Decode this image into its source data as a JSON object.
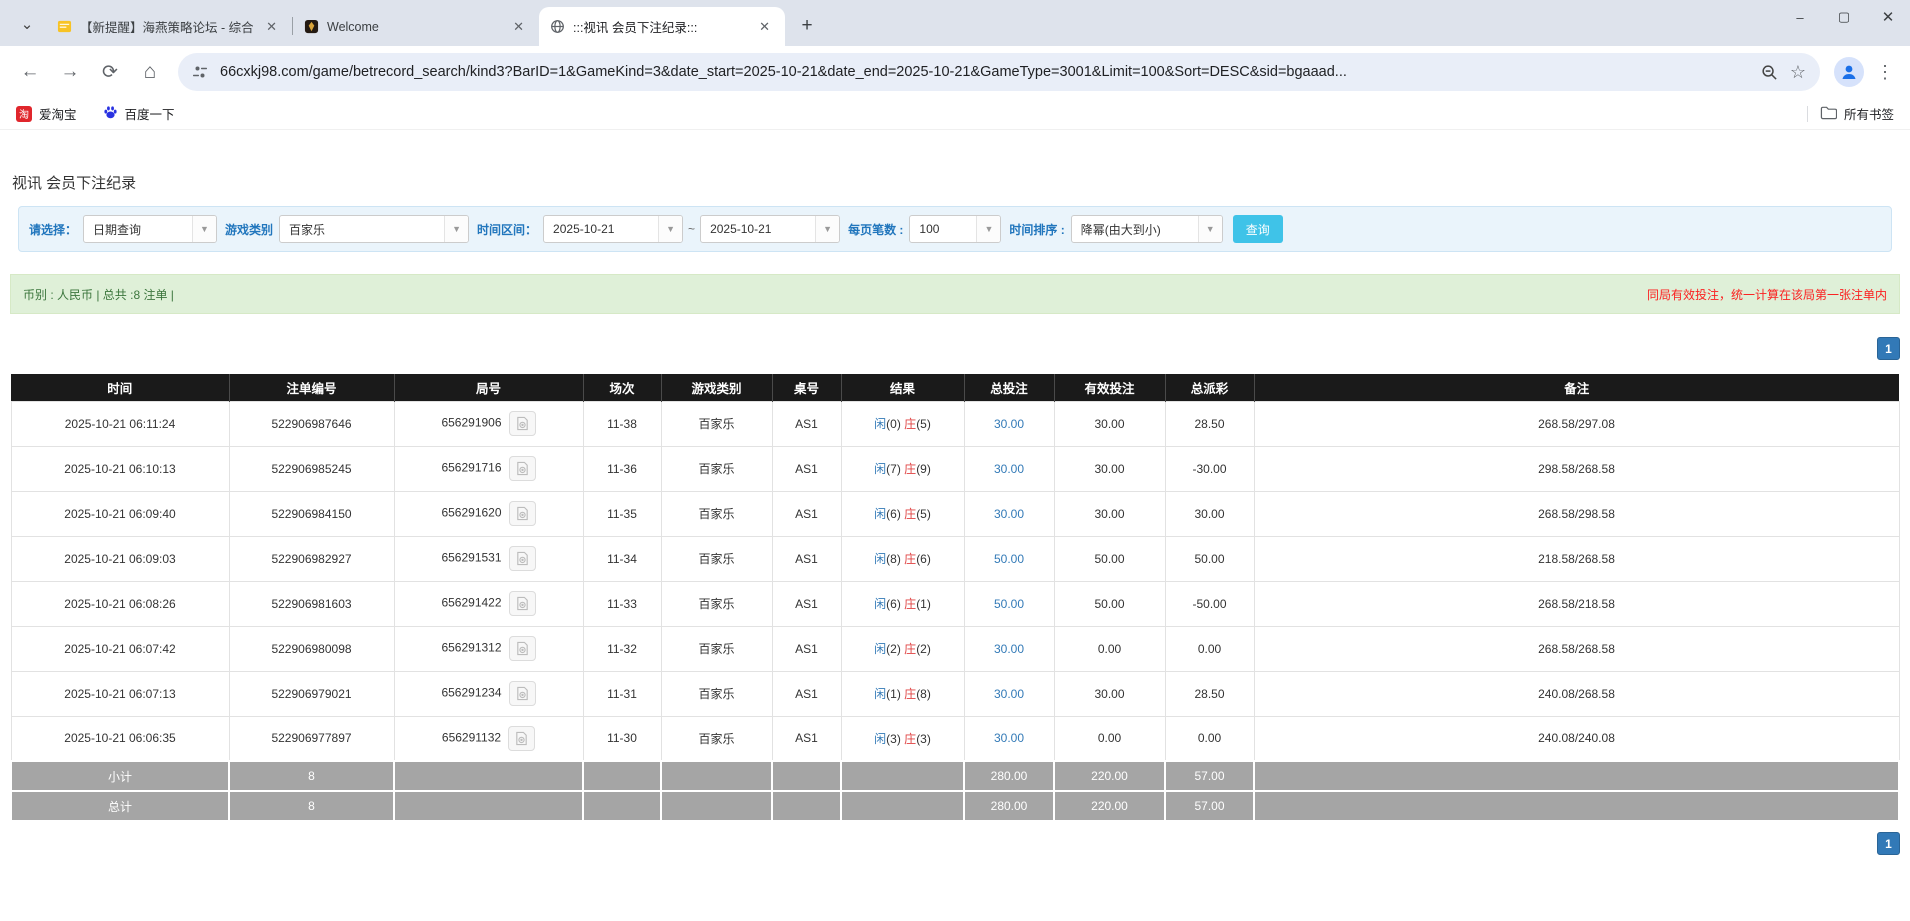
{
  "browser": {
    "tabs": [
      {
        "title": "【新提醒】海燕策略论坛 - 综合",
        "icon": "forum-yellow"
      },
      {
        "title": "Welcome",
        "icon": "dark-gold-emblem"
      },
      {
        "title": ":::视讯 会员下注纪录:::",
        "icon": "globe",
        "active": true
      }
    ],
    "url": "66cxkj98.com/game/betrecord_search/kind3?BarID=1&GameKind=3&date_start=2025-10-21&date_end=2025-10-21&GameType=3001&Limit=100&Sort=DESC&sid=bgaaad...",
    "bookmarks": [
      {
        "label": "爱淘宝",
        "icon": "taobao"
      },
      {
        "label": "百度一下",
        "icon": "baidu-paw"
      }
    ],
    "all_bookmarks_label": "所有书签"
  },
  "page": {
    "title": "视讯 会员下注纪录",
    "filter": {
      "select_label": "请选择：",
      "select_value": "日期查询",
      "game_kind_label": "游戏类别",
      "game_kind_value": "百家乐",
      "range_label": "时间区间：",
      "date_start": "2025-10-21",
      "tilde": "~",
      "date_end": "2025-10-21",
      "per_page_label": "每页笔数 :",
      "per_page_value": "100",
      "sort_label": "时间排序 :",
      "sort_value": "降幂(由大到小)",
      "search_button": "查询"
    },
    "info_bar": {
      "left": "币别 : 人民币 | 总共 :8 注单 |",
      "right": "同局有效投注，统一计算在该局第一张注单内"
    },
    "pagination": "1",
    "table": {
      "headers": [
        "时间",
        "注单编号",
        "局号",
        "场次",
        "游戏类别",
        "桌号",
        "结果",
        "总投注",
        "有效投注",
        "总派彩",
        "备注"
      ],
      "rows": [
        {
          "time": "2025-10-21 06:11:24",
          "bet_id": "522906987646",
          "round": "656291906",
          "session": "11-38",
          "game": "百家乐",
          "table": "AS1",
          "result": {
            "player": "闲(0)",
            "banker": "庄(5)"
          },
          "total_bet": "30.00",
          "valid_bet": "30.00",
          "payout": "28.50",
          "note": "268.58/297.08"
        },
        {
          "time": "2025-10-21 06:10:13",
          "bet_id": "522906985245",
          "round": "656291716",
          "session": "11-36",
          "game": "百家乐",
          "table": "AS1",
          "result": {
            "player": "闲(7)",
            "banker": "庄(9)"
          },
          "total_bet": "30.00",
          "valid_bet": "30.00",
          "payout": "-30.00",
          "note": "298.58/268.58"
        },
        {
          "time": "2025-10-21 06:09:40",
          "bet_id": "522906984150",
          "round": "656291620",
          "session": "11-35",
          "game": "百家乐",
          "table": "AS1",
          "result": {
            "player": "闲(6)",
            "banker": "庄(5)"
          },
          "total_bet": "30.00",
          "valid_bet": "30.00",
          "payout": "30.00",
          "note": "268.58/298.58"
        },
        {
          "time": "2025-10-21 06:09:03",
          "bet_id": "522906982927",
          "round": "656291531",
          "session": "11-34",
          "game": "百家乐",
          "table": "AS1",
          "result": {
            "player": "闲(8)",
            "banker": "庄(6)"
          },
          "total_bet": "50.00",
          "valid_bet": "50.00",
          "payout": "50.00",
          "note": "218.58/268.58"
        },
        {
          "time": "2025-10-21 06:08:26",
          "bet_id": "522906981603",
          "round": "656291422",
          "session": "11-33",
          "game": "百家乐",
          "table": "AS1",
          "result": {
            "player": "闲(6)",
            "banker": "庄(1)"
          },
          "total_bet": "50.00",
          "valid_bet": "50.00",
          "payout": "-50.00",
          "note": "268.58/218.58"
        },
        {
          "time": "2025-10-21 06:07:42",
          "bet_id": "522906980098",
          "round": "656291312",
          "session": "11-32",
          "game": "百家乐",
          "table": "AS1",
          "result": {
            "player": "闲(2)",
            "banker": "庄(2)"
          },
          "total_bet": "30.00",
          "valid_bet": "0.00",
          "payout": "0.00",
          "note": "268.58/268.58"
        },
        {
          "time": "2025-10-21 06:07:13",
          "bet_id": "522906979021",
          "round": "656291234",
          "session": "11-31",
          "game": "百家乐",
          "table": "AS1",
          "result": {
            "player": "闲(1)",
            "banker": "庄(8)"
          },
          "total_bet": "30.00",
          "valid_bet": "30.00",
          "payout": "28.50",
          "note": "240.08/268.58"
        },
        {
          "time": "2025-10-21 06:06:35",
          "bet_id": "522906977897",
          "round": "656291132",
          "session": "11-30",
          "game": "百家乐",
          "table": "AS1",
          "result": {
            "player": "闲(3)",
            "banker": "庄(3)"
          },
          "total_bet": "30.00",
          "valid_bet": "0.00",
          "payout": "0.00",
          "note": "240.08/240.08"
        }
      ],
      "subtotal": {
        "label": "小计",
        "count": "8",
        "total_bet": "280.00",
        "valid_bet": "220.00",
        "payout": "57.00"
      },
      "total": {
        "label": "总计",
        "count": "8",
        "total_bet": "280.00",
        "valid_bet": "220.00",
        "payout": "57.00"
      }
    }
  },
  "colors": {
    "accent-blue": "#337ab7",
    "banker-red": "#e04343",
    "negative-red": "#fb0000",
    "search-cyan": "#3fc3e8",
    "info-green-bg": "#dff0d8",
    "info-green-text": "#3c763d",
    "notice-red": "#fb2020",
    "header-black": "#1a1a1a",
    "summary-grey": "#a5a5a5",
    "pager-blue": "#3279b7",
    "filter-label-blue": "#2176bd",
    "filter-bg": "#eaf4fb"
  }
}
